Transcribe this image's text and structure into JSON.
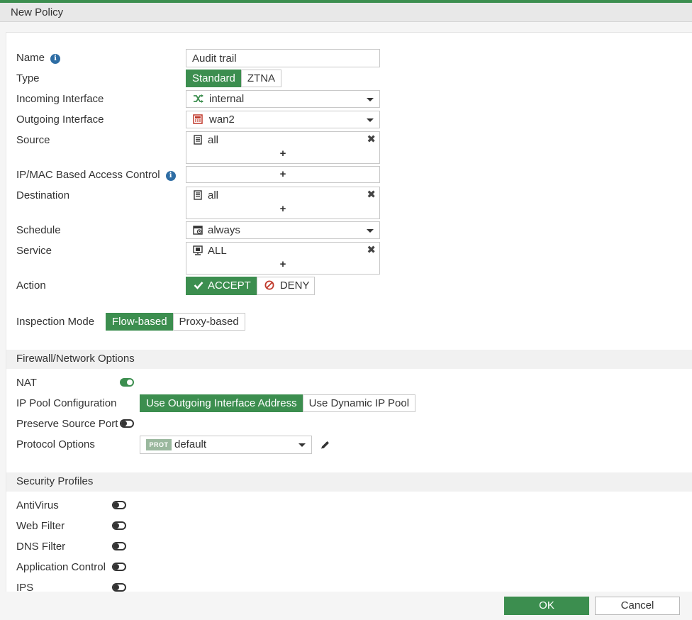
{
  "window": {
    "title": "New Policy"
  },
  "colors": {
    "accent": "#3c8e4f",
    "deny_icon": "#c0392b",
    "info_icon": "#2e6da4",
    "wan_icon": "#c0392b"
  },
  "form": {
    "name": {
      "label": "Name",
      "value": "Audit trail",
      "info_icon": "info-icon"
    },
    "type": {
      "label": "Type",
      "options": [
        "Standard",
        "ZTNA"
      ],
      "selected": "Standard"
    },
    "incoming_interface": {
      "label": "Incoming Interface",
      "value": "internal",
      "icon": "shuffle-icon"
    },
    "outgoing_interface": {
      "label": "Outgoing Interface",
      "value": "wan2",
      "icon": "wan-port-icon"
    },
    "source": {
      "label": "Source",
      "value": "all",
      "icon": "address-icon",
      "add": "+",
      "remove": "✖"
    },
    "ip_mac_access": {
      "label": "IP/MAC Based Access Control",
      "add": "+",
      "info_icon": "info-icon"
    },
    "destination": {
      "label": "Destination",
      "value": "all",
      "icon": "address-icon",
      "add": "+",
      "remove": "✖"
    },
    "schedule": {
      "label": "Schedule",
      "value": "always",
      "icon": "schedule-icon"
    },
    "service": {
      "label": "Service",
      "value": "ALL",
      "icon": "service-icon",
      "add": "+",
      "remove": "✖"
    },
    "action": {
      "label": "Action",
      "accept": "ACCEPT",
      "deny": "DENY",
      "selected": "ACCEPT"
    },
    "inspection_mode": {
      "label": "Inspection Mode",
      "options": [
        "Flow-based",
        "Proxy-based"
      ],
      "selected": "Flow-based"
    }
  },
  "firewall_options": {
    "title": "Firewall/Network Options",
    "nat": {
      "label": "NAT",
      "enabled": true
    },
    "ip_pool": {
      "label": "IP Pool Configuration",
      "options": [
        "Use Outgoing Interface Address",
        "Use Dynamic IP Pool"
      ],
      "selected": "Use Outgoing Interface Address"
    },
    "preserve_source_port": {
      "label": "Preserve Source Port",
      "enabled": false
    },
    "protocol_options": {
      "label": "Protocol Options",
      "badge": "PROT",
      "value": "default"
    }
  },
  "security_profiles": {
    "title": "Security Profiles",
    "items": [
      {
        "label": "AntiVirus",
        "enabled": false
      },
      {
        "label": "Web Filter",
        "enabled": false
      },
      {
        "label": "DNS Filter",
        "enabled": false
      },
      {
        "label": "Application Control",
        "enabled": false
      },
      {
        "label": "IPS",
        "enabled": false
      }
    ]
  },
  "footer": {
    "ok_label": "OK",
    "cancel_label": "Cancel"
  }
}
